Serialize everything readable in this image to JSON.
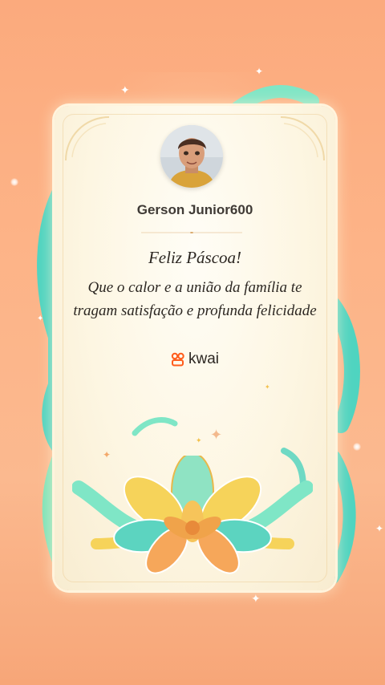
{
  "profile": {
    "username": "Gerson Junior600"
  },
  "greeting": {
    "headline": "Feliz Páscoa!",
    "message": "Que o calor e a união da família te tragam satisfação e profunda felicidade"
  },
  "brand": {
    "name": "kwai",
    "logo_icon": "kwai-logo-icon",
    "color": "#ff5c1b"
  },
  "colors": {
    "background": "#fbaa7d",
    "card": "#fdf6e2",
    "ribbon_teal": "#4fd4c0",
    "ribbon_yellow": "#f6d35a"
  }
}
